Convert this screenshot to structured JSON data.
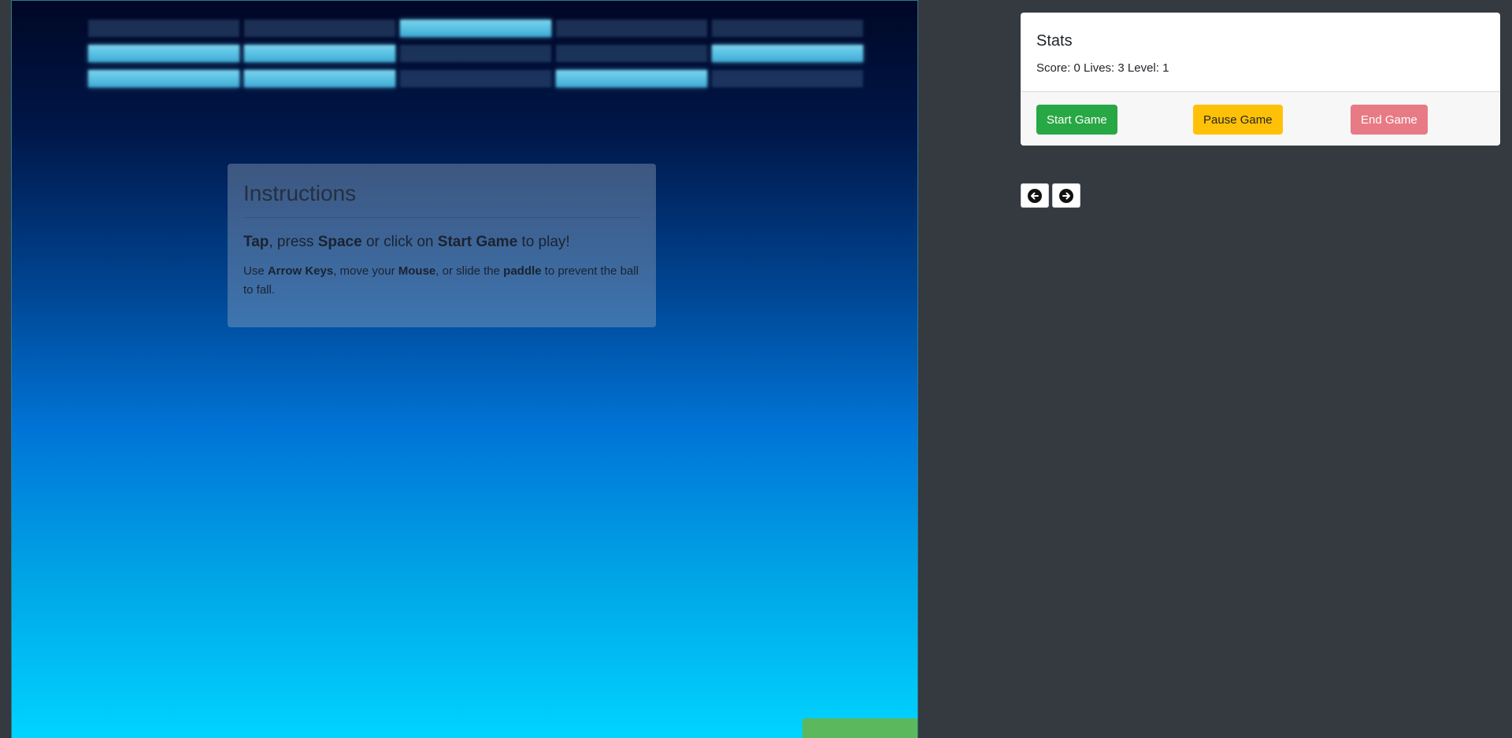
{
  "game": {
    "bricks": [
      [
        false,
        false,
        true,
        false,
        false
      ],
      [
        true,
        true,
        false,
        false,
        true
      ],
      [
        true,
        true,
        false,
        true,
        false
      ]
    ],
    "instructions": {
      "title": "Instructions",
      "lead": [
        {
          "text": "Tap",
          "bold": true
        },
        {
          "text": ", press ",
          "bold": false
        },
        {
          "text": "Space",
          "bold": true
        },
        {
          "text": " or click on ",
          "bold": false
        },
        {
          "text": "Start Game",
          "bold": true
        },
        {
          "text": " to play!",
          "bold": false
        }
      ],
      "detail": [
        {
          "text": "Use ",
          "bold": false
        },
        {
          "text": "Arrow Keys",
          "bold": true
        },
        {
          "text": ", move your ",
          "bold": false
        },
        {
          "text": "Mouse",
          "bold": true
        },
        {
          "text": ", or slide the ",
          "bold": false
        },
        {
          "text": "paddle",
          "bold": true
        },
        {
          "text": " to prevent the ball to fall.",
          "bold": false
        }
      ]
    },
    "colors": {
      "paddle": "#5cb85c",
      "brick_on": "#58bfe2",
      "background_top": "#000725",
      "background_bottom": "#00d4ff"
    }
  },
  "stats": {
    "title": "Stats",
    "line": "Score: 0 Lives: 3 Level: 1",
    "buttons": {
      "start": "Start Game",
      "pause": "Pause Game",
      "end": "End Game"
    },
    "colors": {
      "start": "#28a745",
      "pause": "#ffc107",
      "end": "#e87a85"
    }
  },
  "nav": {
    "prev_icon": "arrow-left-circle-icon",
    "next_icon": "arrow-right-circle-icon"
  }
}
